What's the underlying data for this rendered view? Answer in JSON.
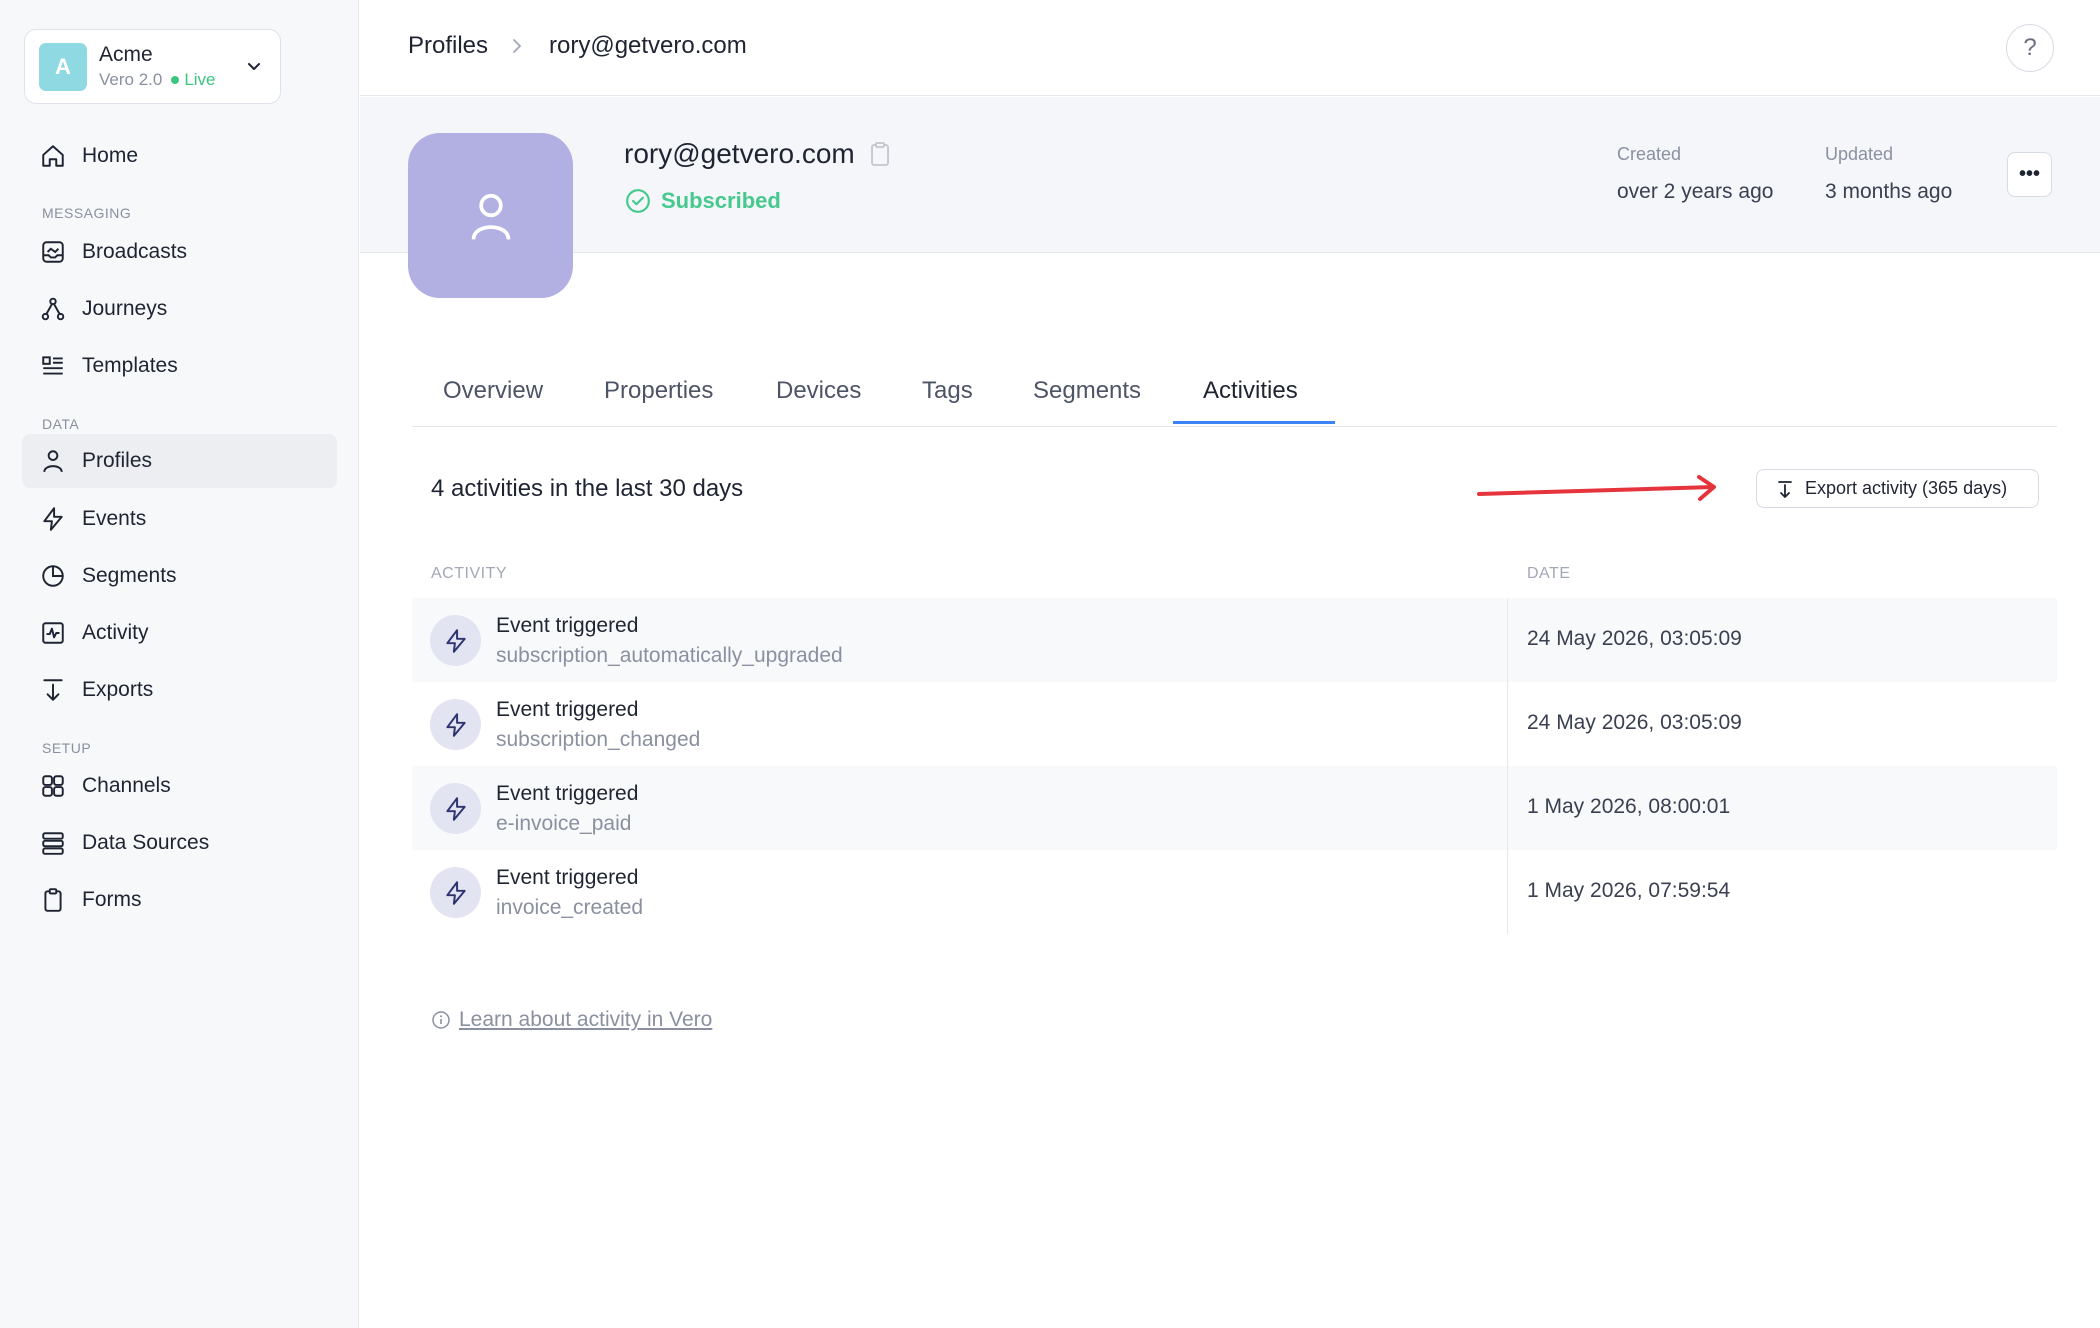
{
  "workspace": {
    "initial": "A",
    "name": "Acme",
    "version": "Vero 2.0",
    "status": "Live"
  },
  "nav": {
    "home": "Home",
    "section_messaging": "MESSAGING",
    "broadcasts": "Broadcasts",
    "journeys": "Journeys",
    "templates": "Templates",
    "section_data": "DATA",
    "profiles": "Profiles",
    "events": "Events",
    "segments": "Segments",
    "activity": "Activity",
    "exports": "Exports",
    "section_setup": "SETUP",
    "channels": "Channels",
    "data_sources": "Data Sources",
    "forms": "Forms"
  },
  "breadcrumb": {
    "parent": "Profiles",
    "current": "rory@getvero.com"
  },
  "help": {
    "label": "?"
  },
  "profile": {
    "email": "rory@getvero.com",
    "status": "Subscribed",
    "created_label": "Created",
    "created_value": "over 2 years ago",
    "updated_label": "Updated",
    "updated_value": "3 months ago",
    "more_label": "•••"
  },
  "tabs": [
    "Overview",
    "Properties",
    "Devices",
    "Tags",
    "Segments",
    "Activities"
  ],
  "activities": {
    "summary": "4 activities in the last 30 days",
    "export_label": "Export activity (365 days)",
    "col_activity": "ACTIVITY",
    "col_date": "DATE",
    "rows": [
      {
        "title": "Event triggered",
        "name": "subscription_automatically_upgraded",
        "date": "24 May 2026, 03:05:09"
      },
      {
        "title": "Event triggered",
        "name": "subscription_changed",
        "date": "24 May 2026, 03:05:09"
      },
      {
        "title": "Event triggered",
        "name": "e-invoice_paid",
        "date": "1 May 2026, 08:00:01"
      },
      {
        "title": "Event triggered",
        "name": "invoice_created",
        "date": "1 May 2026, 07:59:54"
      }
    ],
    "learn_link": "Learn about activity in Vero"
  },
  "colors": {
    "accent": "#3b82f6",
    "live": "#3cc57f",
    "subscribed": "#45c98c",
    "annotation_arrow": "#e5343c"
  }
}
